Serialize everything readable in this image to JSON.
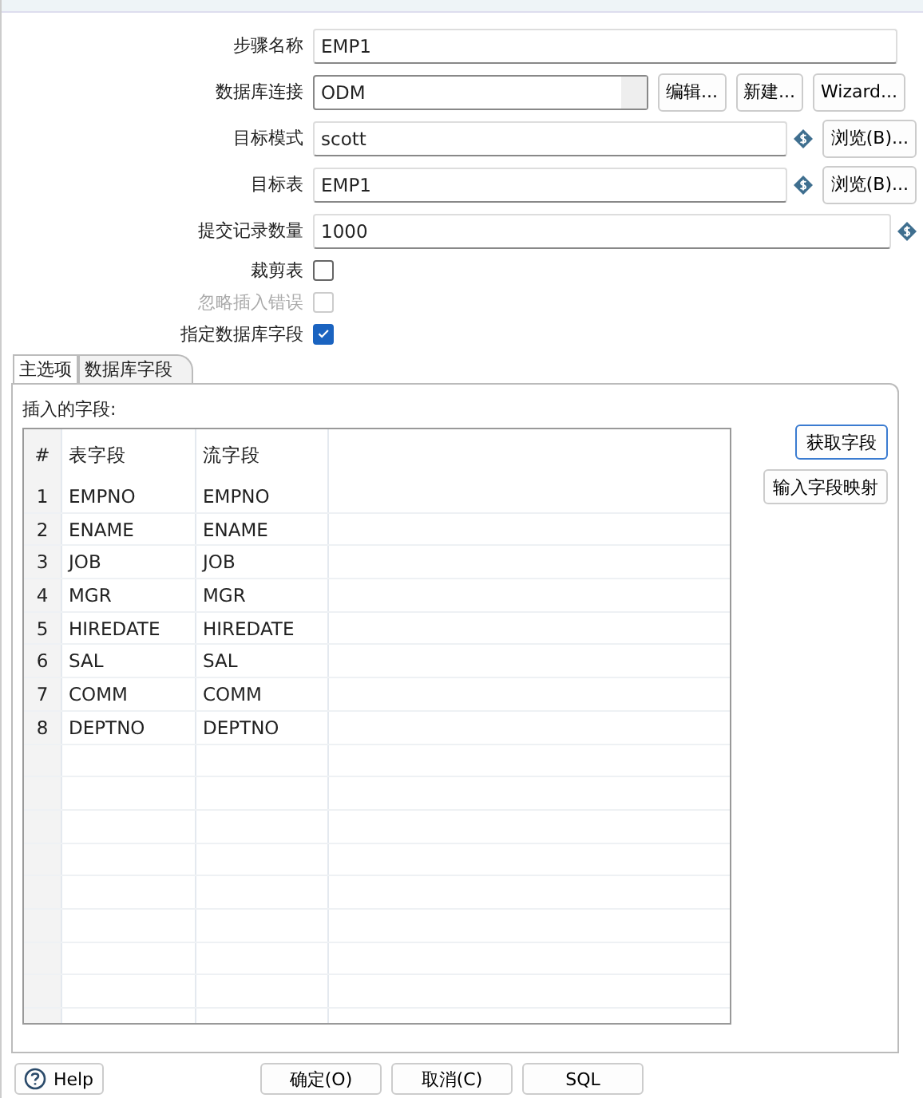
{
  "form": [
    {
      "label": "步骤名称",
      "kind": "text",
      "value": "EMP1",
      "disabled": false,
      "variable": false
    },
    {
      "label": "数据库连接",
      "kind": "combo",
      "value": "ODM",
      "disabled": false,
      "variable": false,
      "buttons": [
        "编辑...",
        "新建...",
        "Wizard..."
      ]
    },
    {
      "label": "目标模式",
      "kind": "text",
      "value": "scott",
      "disabled": false,
      "variable": true,
      "buttons": [
        "浏览(B)..."
      ]
    },
    {
      "label": "目标表",
      "kind": "text",
      "value": "EMP1",
      "disabled": false,
      "variable": true,
      "buttons": [
        "浏览(B)..."
      ]
    },
    {
      "label": "提交记录数量",
      "kind": "text",
      "value": "1000",
      "disabled": false,
      "variable": true
    },
    {
      "label": "裁剪表",
      "kind": "checkbox",
      "checked": false,
      "disabled": false
    },
    {
      "label": "忽略插入错误",
      "kind": "checkbox",
      "checked": false,
      "disabled": true
    },
    {
      "label": "指定数据库字段",
      "kind": "checkbox",
      "checked": true,
      "disabled": false
    }
  ],
  "tabs": [
    {
      "label": "主选项",
      "selected": false
    },
    {
      "label": "数据库字段",
      "selected": true
    }
  ],
  "fields_label": "插入的字段:",
  "table": {
    "columns": [
      "#",
      "表字段",
      "流字段"
    ],
    "rows": [
      [
        "1",
        "EMPNO",
        "EMPNO"
      ],
      [
        "2",
        "ENAME",
        "ENAME"
      ],
      [
        "3",
        "JOB",
        "JOB"
      ],
      [
        "4",
        "MGR",
        "MGR"
      ],
      [
        "5",
        "HIREDATE",
        "HIREDATE"
      ],
      [
        "6",
        "SAL",
        "SAL"
      ],
      [
        "7",
        "COMM",
        "COMM"
      ],
      [
        "8",
        "DEPTNO",
        "DEPTNO"
      ]
    ]
  },
  "side_buttons": [
    {
      "label": "获取字段",
      "focused": true
    },
    {
      "label": "输入字段映射",
      "focused": false
    }
  ],
  "bottom_buttons": [
    {
      "label": "Help",
      "kind": "help"
    },
    {
      "label": "确定(O)",
      "kind": "plain"
    },
    {
      "label": "取消(C)",
      "kind": "plain"
    },
    {
      "label": "SQL",
      "kind": "plain"
    }
  ]
}
